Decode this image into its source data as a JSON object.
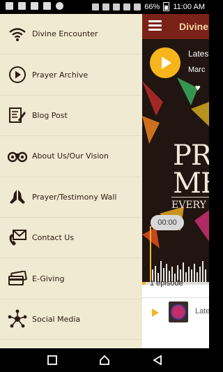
{
  "status_bar": {
    "battery": "66%",
    "time": "11:00 AM"
  },
  "drawer": {
    "items": [
      {
        "label": "Divine Encounter",
        "icon": "wifi-signal-icon"
      },
      {
        "label": "Prayer Archive",
        "icon": "play-circle-icon"
      },
      {
        "label": "Blog Post",
        "icon": "blog-edit-icon"
      },
      {
        "label": "About Us/Our Vision",
        "icon": "binoculars-icon"
      },
      {
        "label": "Prayer/Testimony Wall",
        "icon": "praying-hands-icon"
      },
      {
        "label": "Contact Us",
        "icon": "phone-mail-icon"
      },
      {
        "label": "E-Giving",
        "icon": "credit-card-icon"
      },
      {
        "label": "Social Media",
        "icon": "network-icon"
      }
    ]
  },
  "header": {
    "title": "Divine E"
  },
  "player": {
    "episode_title": "Lates",
    "episode_date": "Marc",
    "artwork_line1": "PR",
    "artwork_line2": "ME",
    "artwork_line3": "EVERY",
    "current_time": "00:00",
    "progress": 0.05
  },
  "episodes": {
    "count_label": "1 episode",
    "row_title": "Late"
  },
  "colors": {
    "drawer_bg": "#f1ead3",
    "header_bg": "#7a2218",
    "accent": "#f6b51b"
  }
}
